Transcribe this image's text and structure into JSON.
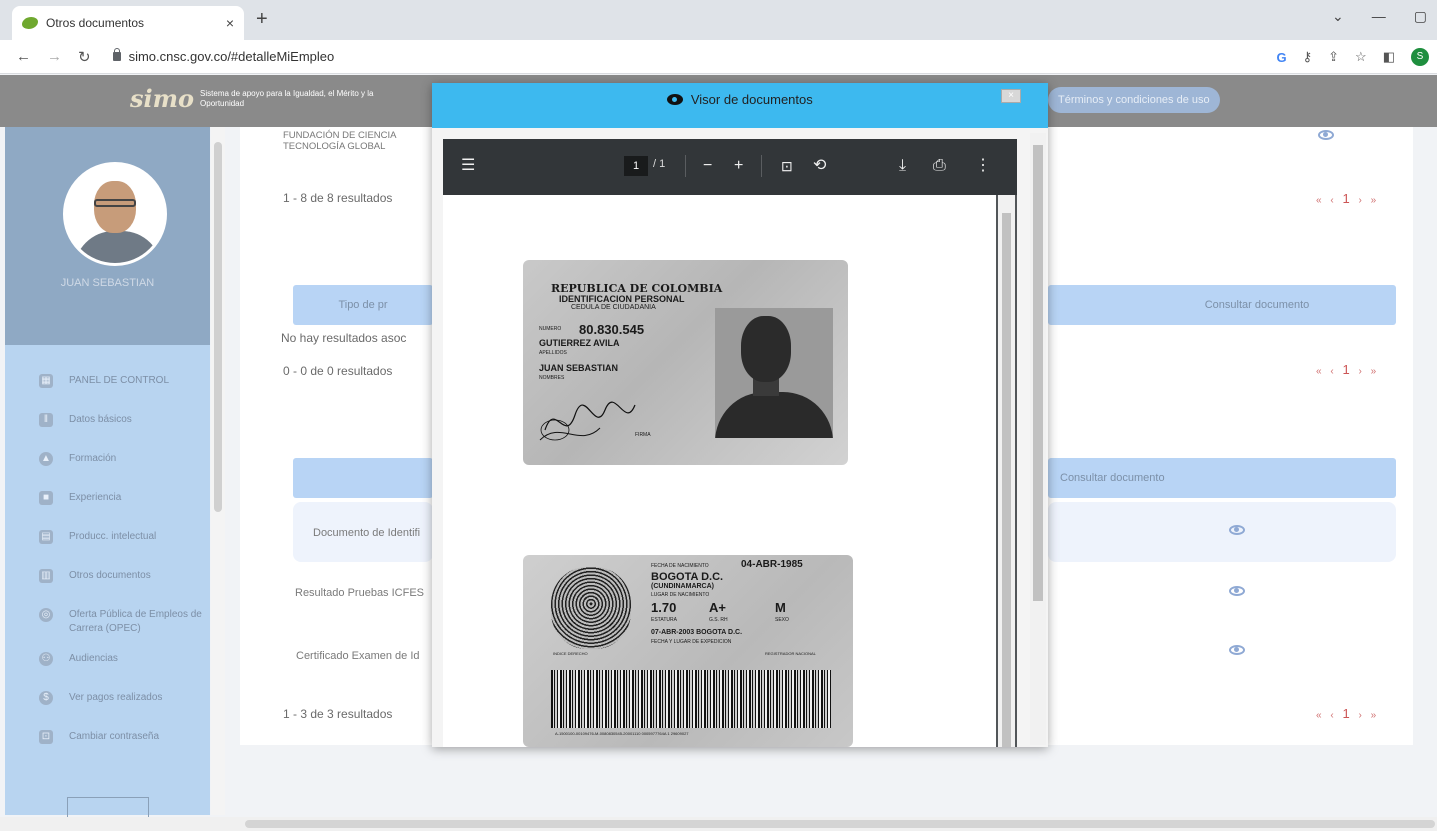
{
  "browser": {
    "tab_title": "Otros documentos",
    "tab_close": "×",
    "new_tab": "+",
    "url": "simo.cnsc.gov.co/#detalleMiEmpleo",
    "profile_initial": "S"
  },
  "header": {
    "logo_mark": "simo",
    "logo_tagline": "Sistema de apoyo para la Igualdad, el Mérito y la Oportunidad",
    "terms_link": "Términos y condiciones de uso"
  },
  "sidebar": {
    "user_name": "JUAN SEBASTIAN",
    "items": [
      {
        "label": "PANEL DE CONTROL",
        "icon": "dashboard-icon"
      },
      {
        "label": "Datos básicos",
        "icon": "people-icon"
      },
      {
        "label": "Formación",
        "icon": "graduation-icon"
      },
      {
        "label": "Experiencia",
        "icon": "briefcase-icon"
      },
      {
        "label": "Producc. intelectual",
        "icon": "book-icon"
      },
      {
        "label": "Otros documentos",
        "icon": "document-icon"
      },
      {
        "label": "Oferta Pública de Empleos de Carrera (OPEC)",
        "icon": "globe-icon"
      },
      {
        "label": "Audiencias",
        "icon": "audience-icon"
      },
      {
        "label": "Ver pagos realizados",
        "icon": "dollar-icon"
      },
      {
        "label": "Cambiar contraseña",
        "icon": "lock-icon"
      }
    ]
  },
  "main": {
    "org_line1": "FUNDACIÓN DE CIENCIA",
    "org_line2": "TECNOLOGÍA GLOBAL",
    "results_1": "1 - 8 de 8 resultados",
    "table2_col1": "Tipo de pr",
    "table2_col_doc": "Consultar documento",
    "no_results": "No hay resultados asoc",
    "results_2": "0 - 0 de 0 resultados",
    "table3_col_doc": "Consultar documento",
    "rows": [
      "Documento de Identifi",
      "Resultado Pruebas ICFES",
      "Certificado Examen de Id"
    ],
    "results_3": "1 - 3 de 3 resultados",
    "pager_prev": "« ‹",
    "pager_page": "1",
    "pager_next": "› »"
  },
  "modal": {
    "title": "Visor de documentos",
    "close_label": "×",
    "pdf": {
      "current_page": "1",
      "total_pages": "/ 1",
      "zoom_out": "−",
      "zoom_in": "+"
    }
  },
  "id_front": {
    "country": "REPUBLICA DE COLOMBIA",
    "doc_type": "IDENTIFICACION PERSONAL",
    "doc_sub": "CEDULA DE CIUDADANIA",
    "numero_label": "NUMERO",
    "numero": "80.830.545",
    "apellidos": "GUTIERREZ AVILA",
    "apellidos_label": "APELLIDOS",
    "nombres": "JUAN SEBASTIAN",
    "nombres_label": "NOMBRES",
    "firma_label": "FIRMA"
  },
  "id_back": {
    "birth_date_label": "FECHA DE NACIMIENTO",
    "birth_date": "04-ABR-1985",
    "birth_place": "BOGOTA D.C.",
    "birth_region": "(CUNDINAMARCA)",
    "birth_place_label": "LUGAR DE NACIMIENTO",
    "height": "1.70",
    "rh": "A+",
    "sex": "M",
    "height_label": "ESTATURA",
    "rh_label": "G.S. RH",
    "sex_label": "SEXO",
    "issue": "07-ABR-2003 BOGOTA D.C.",
    "issue_label": "FECHA Y LUGAR DE EXPEDICION",
    "registrar": "REGISTRADOR NACIONAL",
    "index_label": "INDICE DERECHO",
    "code": "A-1500100-00109476-M-0080830545-20001110   0005977764A 1   29609027"
  }
}
